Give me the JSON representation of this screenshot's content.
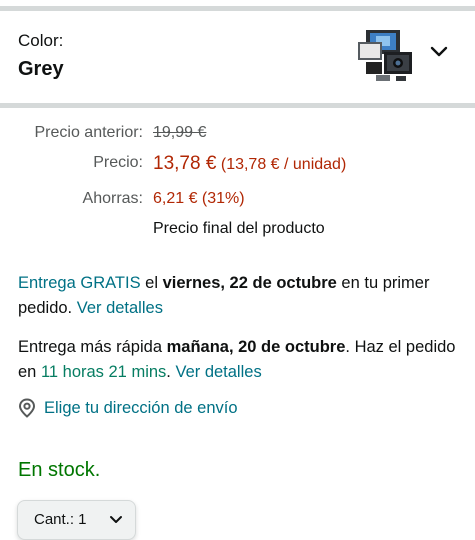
{
  "variation": {
    "label": "Color:",
    "value": "Grey"
  },
  "pricing": {
    "previous_label": "Precio anterior:",
    "previous_value": "19,99 €",
    "price_label": "Precio:",
    "price_value": "13,78 €",
    "price_unit": "(13,78 € / unidad)",
    "savings_label": "Ahorras:",
    "savings_value": "6,21 € (31%)",
    "final_note": "Precio final del producto"
  },
  "delivery": {
    "free_link": "Entrega GRATIS",
    "free_text_1": " el ",
    "free_date": "viernes, 22 de octubre",
    "free_text_2": " en tu primer pedido. ",
    "free_details": "Ver detalles",
    "fast_text_1": "Entrega más rápida ",
    "fast_date": "mañana, 20 de octubre",
    "fast_text_2": ". Haz el pedido en ",
    "fast_countdown": "11 horas 21 mins",
    "fast_text_3": ". ",
    "fast_details": "Ver detalles"
  },
  "address": {
    "label": "Elige tu dirección de envío",
    "icon": "location-pin-icon"
  },
  "stock": {
    "text": "En stock."
  },
  "quantity": {
    "label": "Cant.: 1",
    "icon": "chevron-down-icon"
  },
  "colors": {
    "price_red": "#b12704",
    "link_teal": "#007185",
    "stock_green": "#007600"
  }
}
